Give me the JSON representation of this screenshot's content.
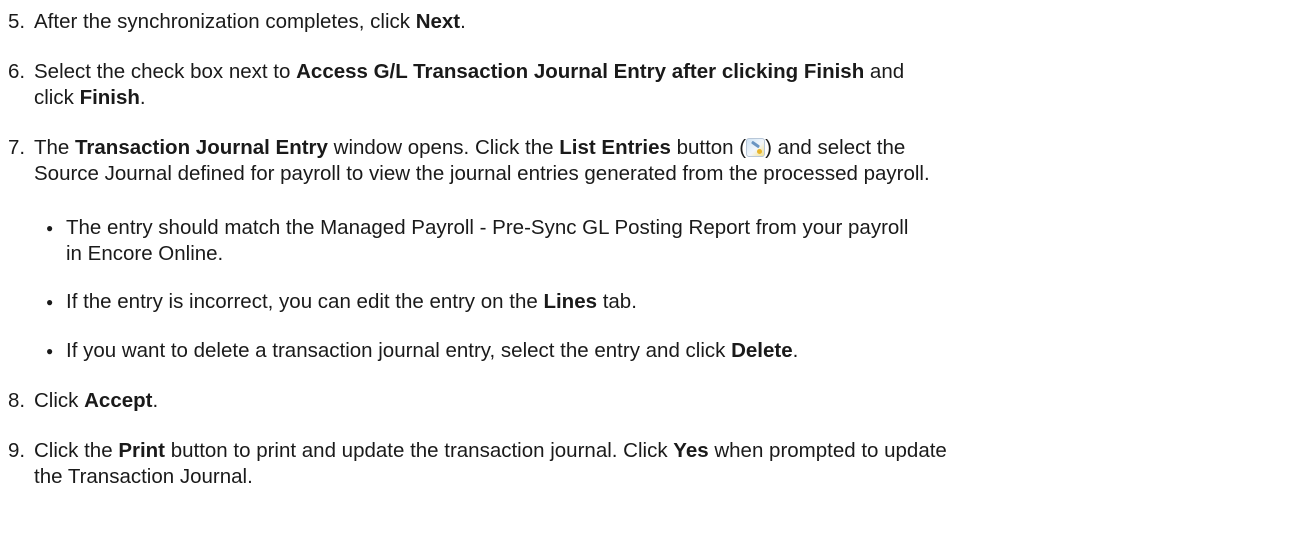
{
  "steps": [
    {
      "num": "5.",
      "parts": [
        "After the synchronization completes, click ",
        "Next",
        "."
      ]
    },
    {
      "num": "6.",
      "line1": [
        "Select the check box next to ",
        "Access G/L Transaction Journal Entry after clicking Finish",
        " and"
      ],
      "line2": [
        "click ",
        "Finish",
        "."
      ]
    },
    {
      "num": "7.",
      "line1": [
        "The ",
        "Transaction Journal Entry",
        " window opens. Click the ",
        "List Entries",
        " button (",
        ") and select the"
      ],
      "line2": "Source Journal defined for payroll to view the journal entries generated from the processed payroll.",
      "icon": "list-entries-icon"
    },
    {
      "num": "8.",
      "parts": [
        "Click ",
        "Accept",
        "."
      ]
    },
    {
      "num": "9.",
      "line1": [
        "Click the ",
        "Print",
        " button to print and update the transaction journal. Click ",
        "Yes",
        " when prompted to update"
      ],
      "line2": "the Transaction Journal."
    }
  ],
  "bullets": [
    {
      "line1": "The entry should match the Managed Payroll - Pre-Sync GL Posting Report from your payroll",
      "line2": "in Encore Online."
    },
    {
      "parts": [
        "If the entry is incorrect, you can edit the entry on the ",
        "Lines",
        " tab."
      ]
    },
    {
      "parts": [
        "If you want to delete a transaction journal entry, select the entry and click ",
        "Delete",
        "."
      ]
    }
  ],
  "bullet_char": "●"
}
